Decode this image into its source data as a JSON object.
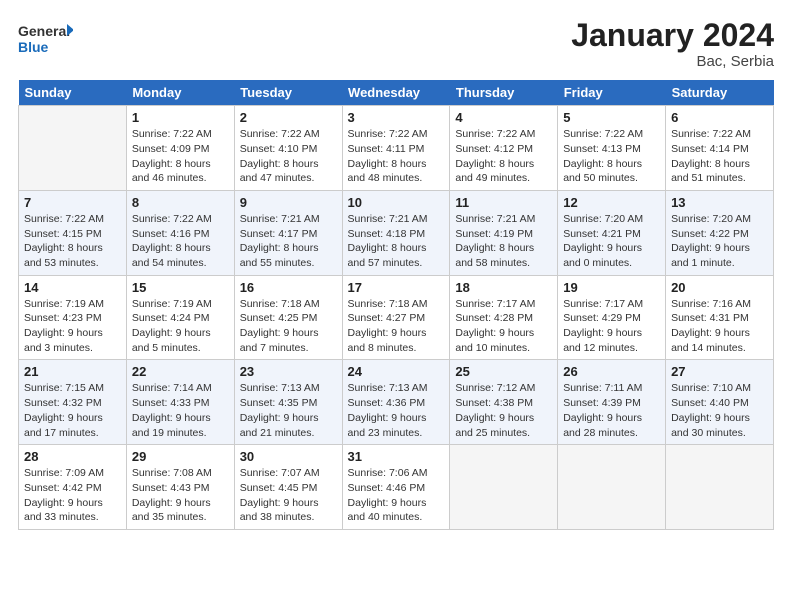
{
  "header": {
    "logo_line1": "General",
    "logo_line2": "Blue",
    "month": "January 2024",
    "location": "Bac, Serbia"
  },
  "weekdays": [
    "Sunday",
    "Monday",
    "Tuesday",
    "Wednesday",
    "Thursday",
    "Friday",
    "Saturday"
  ],
  "weeks": [
    [
      {
        "num": "",
        "sunrise": "",
        "sunset": "",
        "daylight": ""
      },
      {
        "num": "1",
        "sunrise": "7:22 AM",
        "sunset": "4:09 PM",
        "daylight": "8 hours and 46 minutes."
      },
      {
        "num": "2",
        "sunrise": "7:22 AM",
        "sunset": "4:10 PM",
        "daylight": "8 hours and 47 minutes."
      },
      {
        "num": "3",
        "sunrise": "7:22 AM",
        "sunset": "4:11 PM",
        "daylight": "8 hours and 48 minutes."
      },
      {
        "num": "4",
        "sunrise": "7:22 AM",
        "sunset": "4:12 PM",
        "daylight": "8 hours and 49 minutes."
      },
      {
        "num": "5",
        "sunrise": "7:22 AM",
        "sunset": "4:13 PM",
        "daylight": "8 hours and 50 minutes."
      },
      {
        "num": "6",
        "sunrise": "7:22 AM",
        "sunset": "4:14 PM",
        "daylight": "8 hours and 51 minutes."
      }
    ],
    [
      {
        "num": "7",
        "sunrise": "7:22 AM",
        "sunset": "4:15 PM",
        "daylight": "8 hours and 53 minutes."
      },
      {
        "num": "8",
        "sunrise": "7:22 AM",
        "sunset": "4:16 PM",
        "daylight": "8 hours and 54 minutes."
      },
      {
        "num": "9",
        "sunrise": "7:21 AM",
        "sunset": "4:17 PM",
        "daylight": "8 hours and 55 minutes."
      },
      {
        "num": "10",
        "sunrise": "7:21 AM",
        "sunset": "4:18 PM",
        "daylight": "8 hours and 57 minutes."
      },
      {
        "num": "11",
        "sunrise": "7:21 AM",
        "sunset": "4:19 PM",
        "daylight": "8 hours and 58 minutes."
      },
      {
        "num": "12",
        "sunrise": "7:20 AM",
        "sunset": "4:21 PM",
        "daylight": "9 hours and 0 minutes."
      },
      {
        "num": "13",
        "sunrise": "7:20 AM",
        "sunset": "4:22 PM",
        "daylight": "9 hours and 1 minute."
      }
    ],
    [
      {
        "num": "14",
        "sunrise": "7:19 AM",
        "sunset": "4:23 PM",
        "daylight": "9 hours and 3 minutes."
      },
      {
        "num": "15",
        "sunrise": "7:19 AM",
        "sunset": "4:24 PM",
        "daylight": "9 hours and 5 minutes."
      },
      {
        "num": "16",
        "sunrise": "7:18 AM",
        "sunset": "4:25 PM",
        "daylight": "9 hours and 7 minutes."
      },
      {
        "num": "17",
        "sunrise": "7:18 AM",
        "sunset": "4:27 PM",
        "daylight": "9 hours and 8 minutes."
      },
      {
        "num": "18",
        "sunrise": "7:17 AM",
        "sunset": "4:28 PM",
        "daylight": "9 hours and 10 minutes."
      },
      {
        "num": "19",
        "sunrise": "7:17 AM",
        "sunset": "4:29 PM",
        "daylight": "9 hours and 12 minutes."
      },
      {
        "num": "20",
        "sunrise": "7:16 AM",
        "sunset": "4:31 PM",
        "daylight": "9 hours and 14 minutes."
      }
    ],
    [
      {
        "num": "21",
        "sunrise": "7:15 AM",
        "sunset": "4:32 PM",
        "daylight": "9 hours and 17 minutes."
      },
      {
        "num": "22",
        "sunrise": "7:14 AM",
        "sunset": "4:33 PM",
        "daylight": "9 hours and 19 minutes."
      },
      {
        "num": "23",
        "sunrise": "7:13 AM",
        "sunset": "4:35 PM",
        "daylight": "9 hours and 21 minutes."
      },
      {
        "num": "24",
        "sunrise": "7:13 AM",
        "sunset": "4:36 PM",
        "daylight": "9 hours and 23 minutes."
      },
      {
        "num": "25",
        "sunrise": "7:12 AM",
        "sunset": "4:38 PM",
        "daylight": "9 hours and 25 minutes."
      },
      {
        "num": "26",
        "sunrise": "7:11 AM",
        "sunset": "4:39 PM",
        "daylight": "9 hours and 28 minutes."
      },
      {
        "num": "27",
        "sunrise": "7:10 AM",
        "sunset": "4:40 PM",
        "daylight": "9 hours and 30 minutes."
      }
    ],
    [
      {
        "num": "28",
        "sunrise": "7:09 AM",
        "sunset": "4:42 PM",
        "daylight": "9 hours and 33 minutes."
      },
      {
        "num": "29",
        "sunrise": "7:08 AM",
        "sunset": "4:43 PM",
        "daylight": "9 hours and 35 minutes."
      },
      {
        "num": "30",
        "sunrise": "7:07 AM",
        "sunset": "4:45 PM",
        "daylight": "9 hours and 38 minutes."
      },
      {
        "num": "31",
        "sunrise": "7:06 AM",
        "sunset": "4:46 PM",
        "daylight": "9 hours and 40 minutes."
      },
      {
        "num": "",
        "sunrise": "",
        "sunset": "",
        "daylight": ""
      },
      {
        "num": "",
        "sunrise": "",
        "sunset": "",
        "daylight": ""
      },
      {
        "num": "",
        "sunrise": "",
        "sunset": "",
        "daylight": ""
      }
    ]
  ]
}
